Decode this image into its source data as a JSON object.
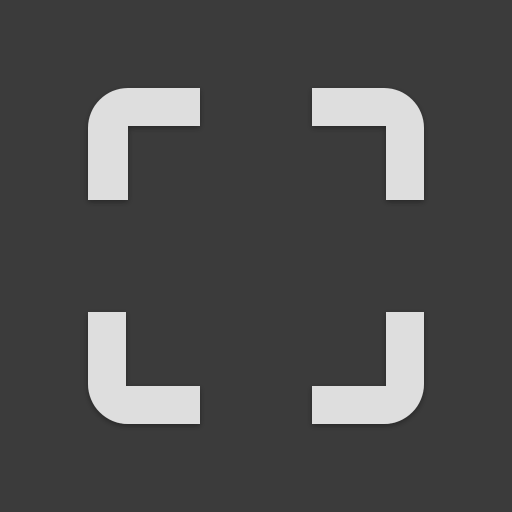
{
  "icon": {
    "name": "fullscreen-icon",
    "background_color": "#3b3b3b",
    "bracket_color": "#dedede",
    "shadow_color": "#2a2a2a"
  }
}
